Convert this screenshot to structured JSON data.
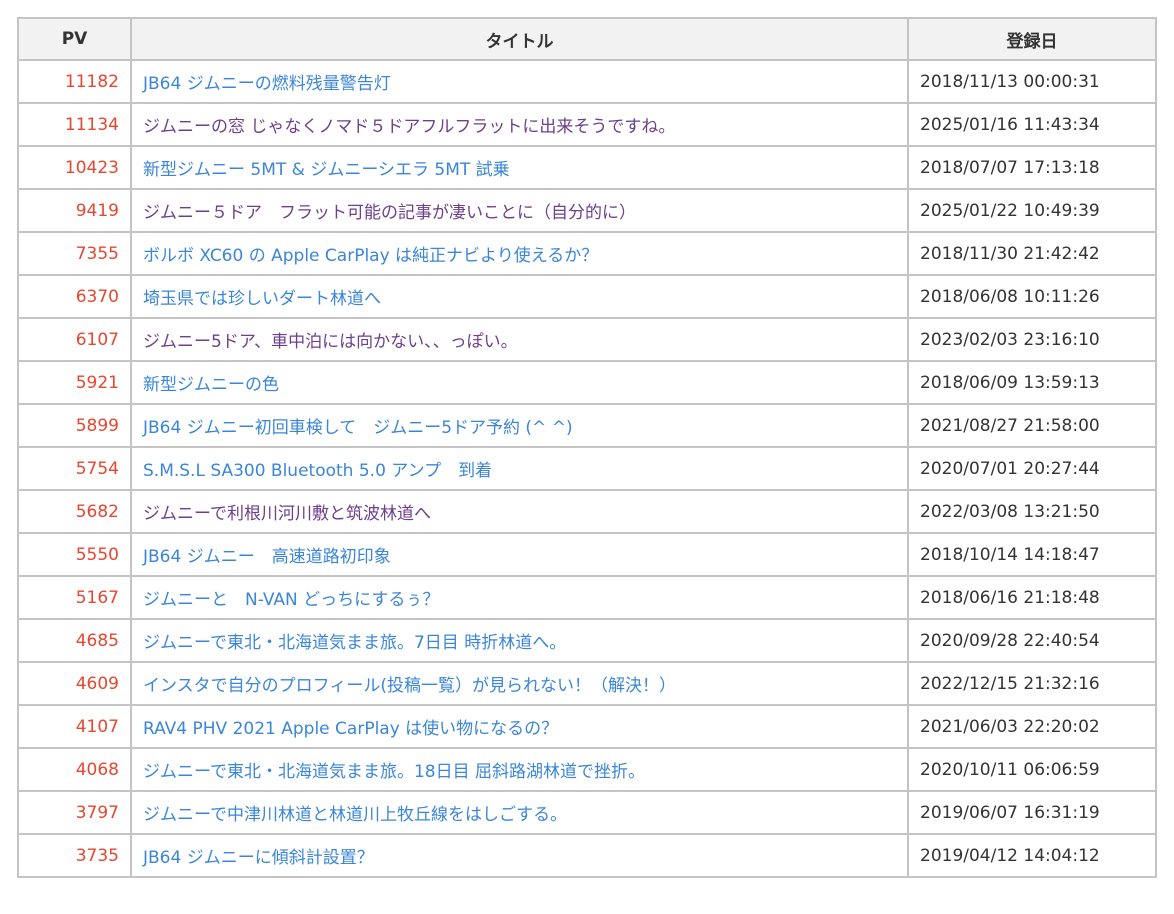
{
  "table": {
    "headers": {
      "pv": "PV",
      "title": "タイトル",
      "date": "登録日"
    },
    "rows": [
      {
        "pv": "11182",
        "title": "JB64 ジムニーの燃料残量警告灯",
        "date": "2018/11/13 00:00:31",
        "visited": false
      },
      {
        "pv": "11134",
        "title": "ジムニーの窓 じゃなくノマド５ドアフルフラットに出来そうですね。",
        "date": "2025/01/16 11:43:34",
        "visited": true
      },
      {
        "pv": "10423",
        "title": "新型ジムニー 5MT & ジムニーシエラ 5MT 試乗",
        "date": "2018/07/07 17:13:18",
        "visited": false
      },
      {
        "pv": "9419",
        "title": "ジムニー５ドア　フラット可能の記事が凄いことに（自分的に）",
        "date": "2025/01/22 10:49:39",
        "visited": true
      },
      {
        "pv": "7355",
        "title": "ボルボ XC60 の Apple CarPlay は純正ナビより使えるか？",
        "date": "2018/11/30 21:42:42",
        "visited": false
      },
      {
        "pv": "6370",
        "title": "埼玉県では珍しいダート林道へ",
        "date": "2018/06/08 10:11:26",
        "visited": false
      },
      {
        "pv": "6107",
        "title": "ジムニー5ドア、車中泊には向かない、、っぽい。",
        "date": "2023/02/03 23:16:10",
        "visited": true
      },
      {
        "pv": "5921",
        "title": "新型ジムニーの色",
        "date": "2018/06/09 13:59:13",
        "visited": false
      },
      {
        "pv": "5899",
        "title": "JB64 ジムニー初回車検して　ジムニー5ドア予約 (^ ^)",
        "date": "2021/08/27 21:58:00",
        "visited": false
      },
      {
        "pv": "5754",
        "title": "S.M.S.L SA300 Bluetooth 5.0 アンプ　到着",
        "date": "2020/07/01 20:27:44",
        "visited": false
      },
      {
        "pv": "5682",
        "title": "ジムニーで利根川河川敷と筑波林道へ",
        "date": "2022/03/08 13:21:50",
        "visited": true
      },
      {
        "pv": "5550",
        "title": "JB64 ジムニー　高速道路初印象",
        "date": "2018/10/14 14:18:47",
        "visited": false
      },
      {
        "pv": "5167",
        "title": "ジムニーと　N-VAN どっちにするぅ？",
        "date": "2018/06/16 21:18:48",
        "visited": false
      },
      {
        "pv": "4685",
        "title": "ジムニーで東北・北海道気まま旅。7日目 時折林道へ。",
        "date": "2020/09/28 22:40:54",
        "visited": false
      },
      {
        "pv": "4609",
        "title": "インスタで自分のプロフィール(投稿一覧）が見られない！（解決！）",
        "date": "2022/12/15 21:32:16",
        "visited": false
      },
      {
        "pv": "4107",
        "title": "RAV4 PHV 2021 Apple CarPlay は使い物になるの？",
        "date": "2021/06/03 22:20:02",
        "visited": false
      },
      {
        "pv": "4068",
        "title": "ジムニーで東北・北海道気まま旅。18日目 屈斜路湖林道で挫折。",
        "date": "2020/10/11 06:06:59",
        "visited": false
      },
      {
        "pv": "3797",
        "title": "ジムニーで中津川林道と林道川上牧丘線をはしごする。",
        "date": "2019/06/07 16:31:19",
        "visited": false
      },
      {
        "pv": "3735",
        "title": "JB64 ジムニーに傾斜計設置？",
        "date": "2019/04/12 14:04:12",
        "visited": false
      }
    ]
  }
}
